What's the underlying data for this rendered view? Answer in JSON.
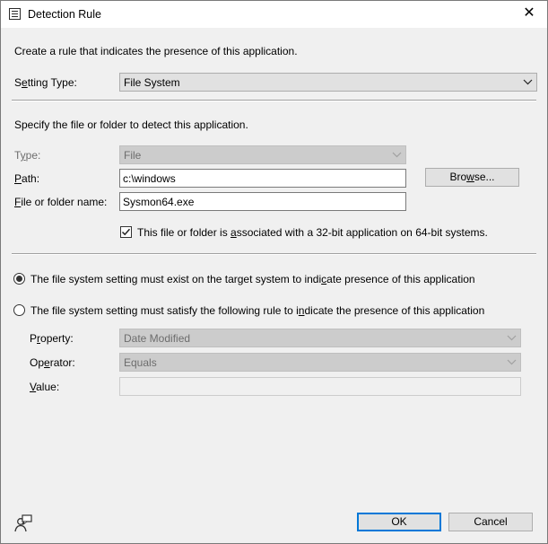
{
  "window": {
    "title": "Detection Rule",
    "close_glyph": "✕"
  },
  "intro": {
    "text": "Create a rule that indicates the presence of this application."
  },
  "setting_type": {
    "label_pre": "S",
    "label_acc": "e",
    "label_post": "tting Type:",
    "value": "File System"
  },
  "specify": {
    "text": "Specify the file or folder to detect this application."
  },
  "type": {
    "label_pre": "T",
    "label_acc": "y",
    "label_post": "pe:",
    "value": "File"
  },
  "path": {
    "label_acc": "P",
    "label_post": "ath:",
    "value": "c:\\windows"
  },
  "browse": {
    "label_pre": "Bro",
    "label_acc": "w",
    "label_post": "se..."
  },
  "name": {
    "label_acc": "F",
    "label_post": "ile or folder name:",
    "value": "Sysmon64.exe"
  },
  "checkbox_32bit": {
    "checked": true,
    "label_pre": "This file or folder is ",
    "label_acc": "a",
    "label_post": "ssociated with a 32-bit application on 64-bit systems."
  },
  "radio_exist": {
    "selected": true,
    "label_pre": "The file system setting must exist on the target system to indi",
    "label_acc": "c",
    "label_post": "ate presence of this application"
  },
  "radio_rule": {
    "selected": false,
    "label_pre": "The file system setting must satisfy the following rule to i",
    "label_acc": "n",
    "label_post": "dicate the presence of this application"
  },
  "property": {
    "label_pre": "P",
    "label_acc": "r",
    "label_post": "operty:",
    "value": "Date Modified"
  },
  "operator": {
    "label_pre": "Op",
    "label_acc": "e",
    "label_post": "rator:",
    "value": "Equals"
  },
  "value": {
    "label_acc": "V",
    "label_post": "alue:",
    "value": ""
  },
  "footer": {
    "ok_label": "OK",
    "cancel_label": "Cancel"
  }
}
